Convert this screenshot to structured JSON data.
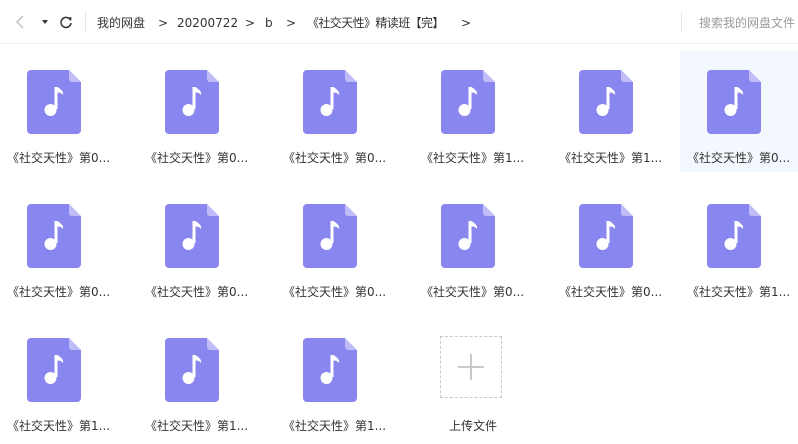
{
  "toolbar": {
    "back_icon": "chevron-left-icon",
    "dropdown_icon": "caret-down-icon",
    "refresh_icon": "refresh-icon"
  },
  "breadcrumb": {
    "items": [
      "我的网盘",
      "20200722",
      "b",
      "《社交天性》精读班【完】"
    ],
    "separator": ">"
  },
  "search": {
    "placeholder": "搜索我的网盘文件"
  },
  "colors": {
    "file_icon": "#8a86f0",
    "selected_bg": "#f3f8fe"
  },
  "files": [
    {
      "name": "《社交天性》第0...",
      "icon": "audio-file-icon",
      "selected": false
    },
    {
      "name": "《社交天性》第0...",
      "icon": "audio-file-icon",
      "selected": false
    },
    {
      "name": "《社交天性》第0...",
      "icon": "audio-file-icon",
      "selected": false
    },
    {
      "name": "《社交天性》第1...",
      "icon": "audio-file-icon",
      "selected": false
    },
    {
      "name": "《社交天性》第1...",
      "icon": "audio-file-icon",
      "selected": false
    },
    {
      "name": "《社交天性》第0...",
      "icon": "audio-file-icon",
      "selected": true
    },
    {
      "name": "《社交天性》第0...",
      "icon": "audio-file-icon",
      "selected": false
    },
    {
      "name": "《社交天性》第0...",
      "icon": "audio-file-icon",
      "selected": false
    },
    {
      "name": "《社交天性》第0...",
      "icon": "audio-file-icon",
      "selected": false
    },
    {
      "name": "《社交天性》第0...",
      "icon": "audio-file-icon",
      "selected": false
    },
    {
      "name": "《社交天性》第0...",
      "icon": "audio-file-icon",
      "selected": false
    },
    {
      "name": "《社交天性》第1...",
      "icon": "audio-file-icon",
      "selected": false
    },
    {
      "name": "《社交天性》第1...",
      "icon": "audio-file-icon",
      "selected": false
    },
    {
      "name": "《社交天性》第1...",
      "icon": "audio-file-icon",
      "selected": false
    },
    {
      "name": "《社交天性》第1...",
      "icon": "audio-file-icon",
      "selected": false
    }
  ],
  "upload": {
    "label": "上传文件",
    "icon": "plus-icon"
  }
}
